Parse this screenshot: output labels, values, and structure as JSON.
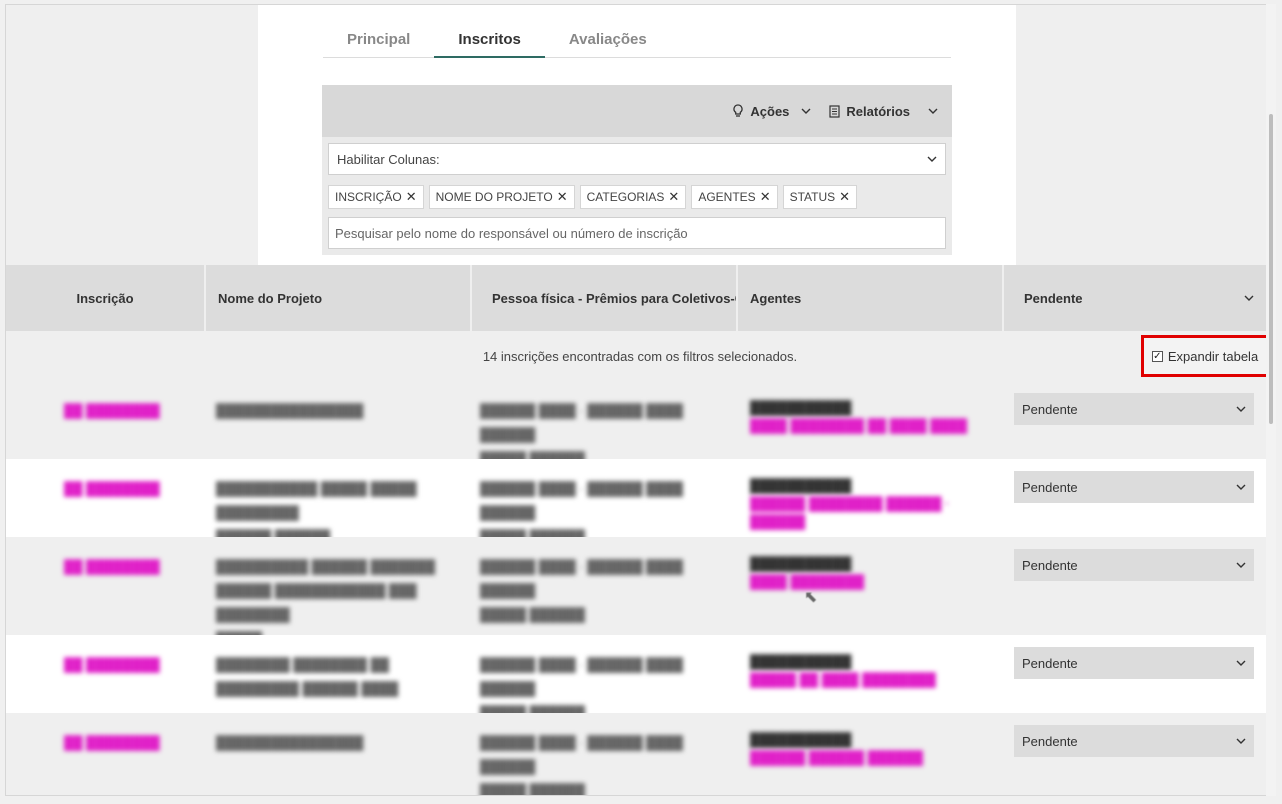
{
  "tabs": [
    {
      "label": "Principal",
      "active": false
    },
    {
      "label": "Inscritos",
      "active": true
    },
    {
      "label": "Avaliações",
      "active": false
    }
  ],
  "toolbar": {
    "actions_label": "Ações",
    "actions_icon": "lightbulb-icon",
    "reports_label": "Relatórios",
    "reports_icon": "document-icon"
  },
  "filters": {
    "columns_select": "Habilitar Colunas:",
    "chips": [
      "INSCRIÇÃO",
      "NOME DO PROJETO",
      "CATEGORIAS",
      "AGENTES",
      "STATUS"
    ],
    "search_placeholder": "Pesquisar pelo nome do responsável ou número de inscrição"
  },
  "table": {
    "headers": [
      "Inscrição",
      "Nome do Projeto",
      "Pessoa física - Prêmios para Coletivos-C",
      "Agentes",
      "Pendente"
    ],
    "info": "14 inscrições encontradas com os filtros selecionados.",
    "expand_label": "Expandir tabela",
    "expand_checked": true,
    "rows": [
      {
        "status": "Pendente"
      },
      {
        "status": "Pendente"
      },
      {
        "status": "Pendente"
      },
      {
        "status": "Pendente"
      },
      {
        "status": "Pendente"
      }
    ]
  },
  "colors": {
    "accent_tab": "#2e6b63",
    "link_pink": "#e020c8",
    "highlight_red": "#e00000",
    "header_gray": "#dcdcdc"
  }
}
